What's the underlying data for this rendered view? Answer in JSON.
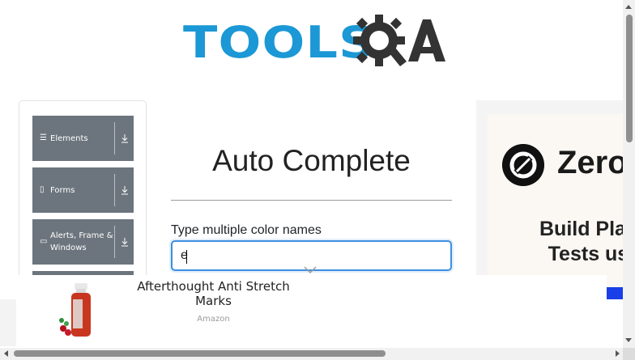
{
  "header": {
    "logo_text": "TOOLS",
    "logo_suffix": "QA",
    "colors": {
      "logo_blue": "#1b98d5",
      "logo_dark": "#333333"
    }
  },
  "sidebar": {
    "groups": [
      {
        "label": "Elements",
        "icon": "hamburger-icon",
        "action_icon": "download-icon"
      },
      {
        "label": "Forms",
        "icon": "form-icon",
        "action_icon": "download-icon"
      },
      {
        "label": "Alerts, Frame & Windows",
        "icon": "window-icon",
        "action_icon": "download-icon"
      }
    ],
    "colors": {
      "group_bg": "#6c757d"
    }
  },
  "main": {
    "title": "Auto Complete",
    "field_label": "Type multiple color names",
    "input_value": "e",
    "colors": {
      "input_focus_border": "#3d8fe0"
    }
  },
  "right_ad": {
    "brand": "Zero",
    "tagline_line1": "Build Play",
    "tagline_line2": "Tests us"
  },
  "bottom_ad": {
    "product_title": "Afterthought Anti Stretch Marks",
    "source": "Amazon",
    "collapse_icon": "chevron-down-icon"
  }
}
